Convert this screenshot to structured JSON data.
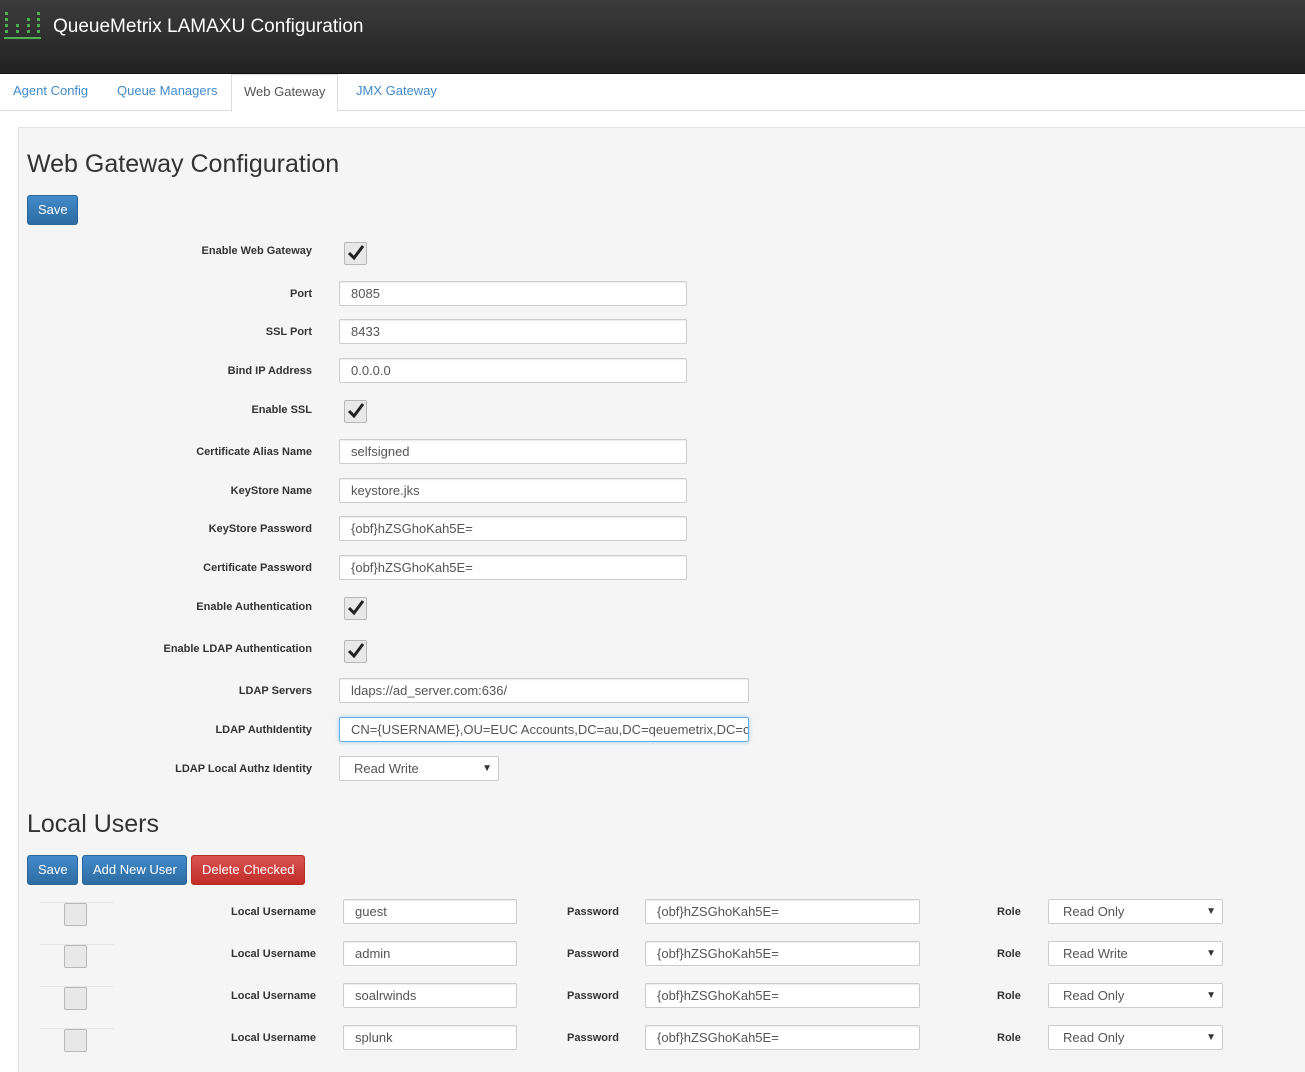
{
  "app": {
    "title": "QueueMetrix LAMAXU Configuration",
    "logo_icon": "bar-chart-logo-icon",
    "accent_color": "#4caf50"
  },
  "tabs": [
    {
      "label": "Agent Config"
    },
    {
      "label": "Queue Managers"
    },
    {
      "label": "Web Gateway"
    },
    {
      "label": "JMX Gateway"
    }
  ],
  "active_tab": "Web Gateway",
  "page": {
    "title": "Web Gateway Configuration",
    "save_label": "Save"
  },
  "form": {
    "enable_web_gateway": {
      "label": "Enable Web Gateway",
      "checked": true
    },
    "port": {
      "label": "Port",
      "value": "8085"
    },
    "ssl_port": {
      "label": "SSL Port",
      "value": "8433"
    },
    "bind_ip": {
      "label": "Bind IP Address",
      "value": "0.0.0.0"
    },
    "enable_ssl": {
      "label": "Enable SSL",
      "checked": true
    },
    "cert_alias": {
      "label": "Certificate Alias Name",
      "value": "selfsigned"
    },
    "keystore_name": {
      "label": "KeyStore Name",
      "value": "keystore.jks"
    },
    "keystore_password": {
      "label": "KeyStore Password",
      "value": "{obf}hZSGhoKah5E="
    },
    "cert_password": {
      "label": "Certificate Password",
      "value": "{obf}hZSGhoKah5E="
    },
    "enable_auth": {
      "label": "Enable Authentication",
      "checked": true
    },
    "enable_ldap_auth": {
      "label": "Enable LDAP Authentication",
      "checked": true
    },
    "ldap_servers": {
      "label": "LDAP Servers",
      "value": "ldaps://ad_server.com:636/"
    },
    "ldap_authidentity": {
      "label": "LDAP AuthIdentity",
      "value": "CN={USERNAME},OU=EUC Accounts,DC=au,DC=qeuemetrix,DC=co"
    },
    "ldap_local_authz": {
      "label": "LDAP Local Authz Identity",
      "value": "Read Write"
    }
  },
  "local_users": {
    "title": "Local Users",
    "save_label": "Save",
    "add_label": "Add New User",
    "delete_label": "Delete Checked",
    "username_label": "Local Username",
    "password_label": "Password",
    "role_label": "Role",
    "rows": [
      {
        "username": "guest",
        "password": "{obf}hZSGhoKah5E=",
        "role": "Read Only"
      },
      {
        "username": "admin",
        "password": "{obf}hZSGhoKah5E=",
        "role": "Read Write"
      },
      {
        "username": "soalrwinds",
        "password": "{obf}hZSGhoKah5E=",
        "role": "Read Only"
      },
      {
        "username": "splunk",
        "password": "{obf}hZSGhoKah5E=",
        "role": "Read Only"
      }
    ]
  }
}
